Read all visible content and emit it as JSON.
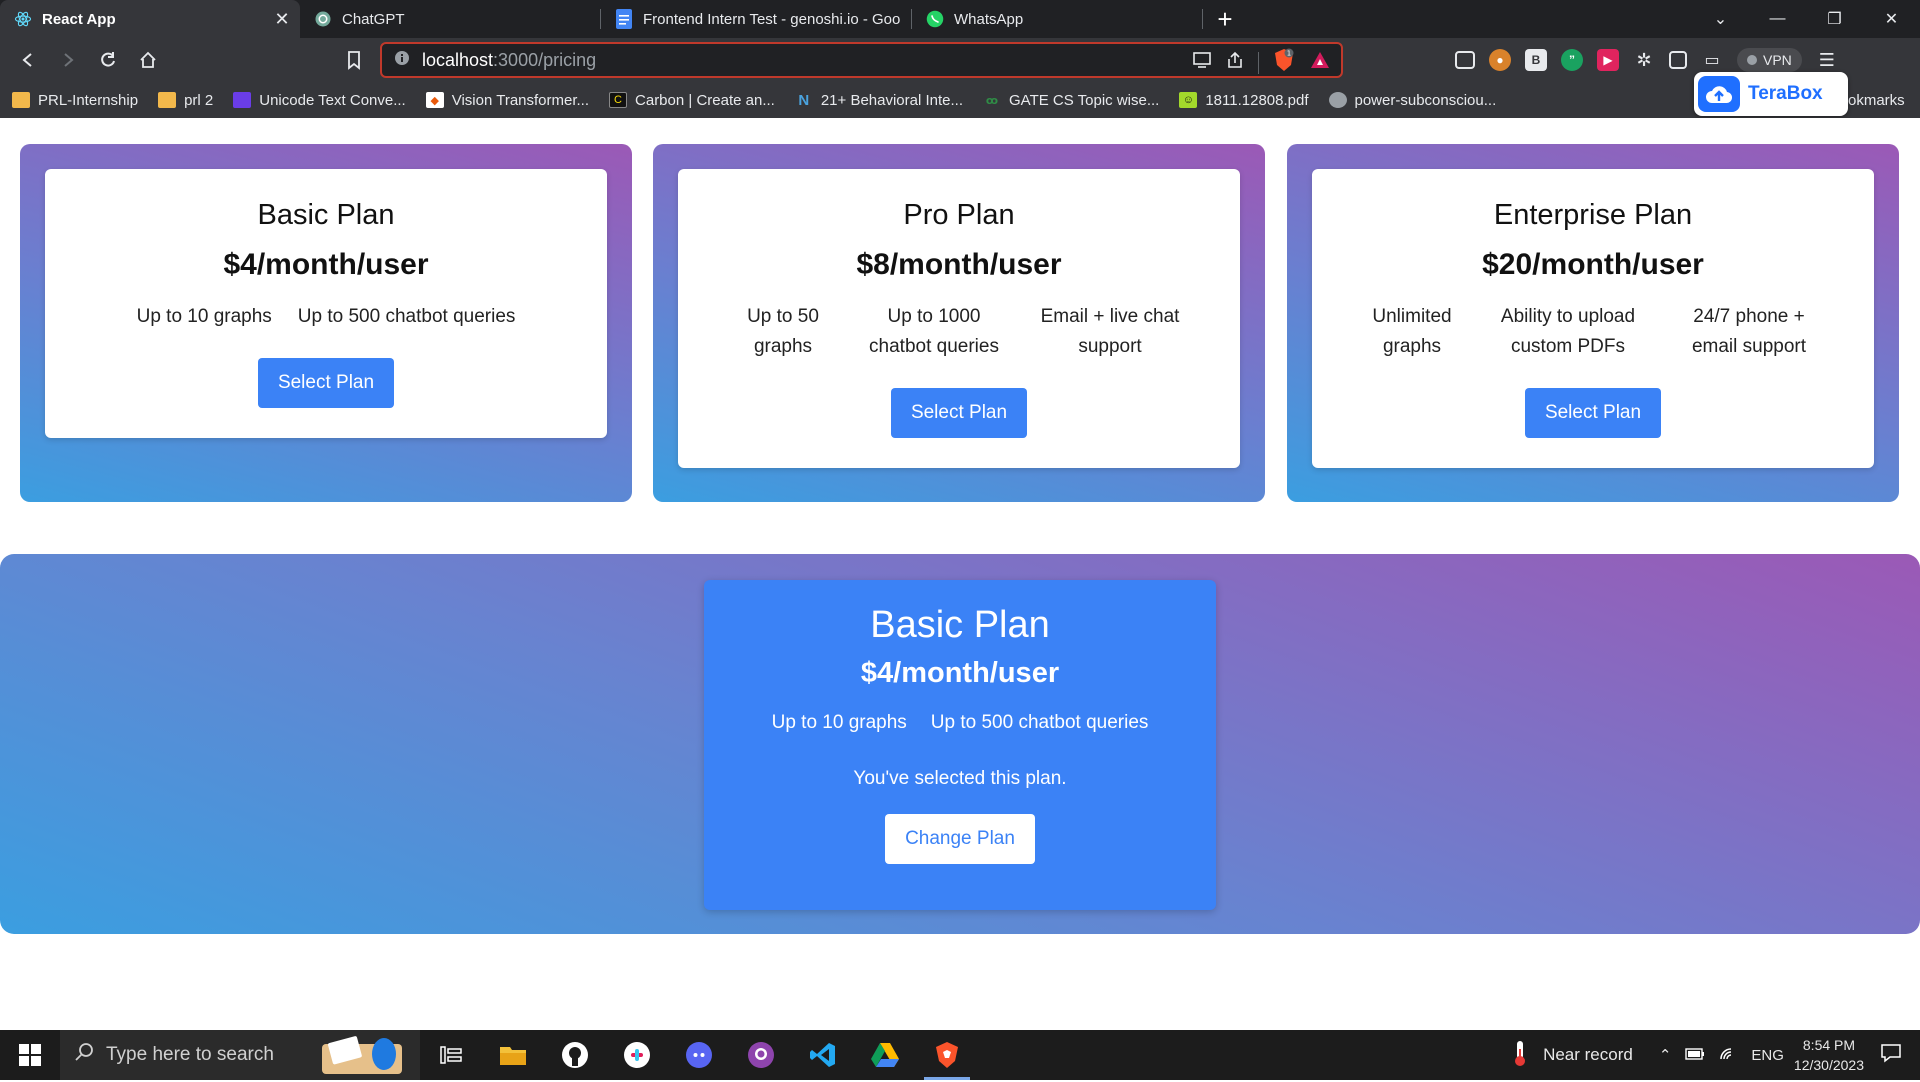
{
  "browser": {
    "tabs": [
      {
        "title": "React App",
        "active": true
      },
      {
        "title": "ChatGPT",
        "active": false
      },
      {
        "title": "Frontend Intern Test - genoshi.io - Goo",
        "active": false
      },
      {
        "title": "WhatsApp",
        "active": false
      }
    ],
    "url_host": "localhost",
    "url_path": ":3000/pricing",
    "vpn_label": "VPN",
    "bookmarks": [
      {
        "label": "PRL-Internship",
        "icon": "folder-icon"
      },
      {
        "label": "prl 2",
        "icon": "folder-icon"
      },
      {
        "label": "Unicode Text Conve...",
        "icon": "unicode-icon"
      },
      {
        "label": "Vision Transformer...",
        "icon": "vision-icon"
      },
      {
        "label": "Carbon | Create an...",
        "icon": "carbon-icon"
      },
      {
        "label": "21+ Behavioral Inte...",
        "icon": "n-icon"
      },
      {
        "label": "GATE CS Topic wise...",
        "icon": "gfg-icon"
      },
      {
        "label": "1811.12808.pdf",
        "icon": "pdf-icon"
      },
      {
        "label": "power-subconsciou...",
        "icon": "globe-icon"
      }
    ],
    "bookmarks_tail": "okmarks",
    "terabox_label": "TeraBox"
  },
  "plans": [
    {
      "name": "Basic Plan",
      "price": "$4/month/user",
      "features": [
        "Up to 10 graphs",
        "Up to 500 chatbot queries"
      ],
      "button": "Select Plan"
    },
    {
      "name": "Pro Plan",
      "price": "$8/month/user",
      "features": [
        "Up to 50 graphs",
        "Up to 1000 chatbot queries",
        "Email + live chat support"
      ],
      "button": "Select Plan"
    },
    {
      "name": "Enterprise Plan",
      "price": "$20/month/user",
      "features": [
        "Unlimited graphs",
        "Ability to upload custom PDFs",
        "24/7 phone + email support"
      ],
      "button": "Select Plan"
    }
  ],
  "selected": {
    "name": "Basic Plan",
    "price": "$4/month/user",
    "features": [
      "Up to 10 graphs",
      "Up to 500 chatbot queries"
    ],
    "message": "You've selected this plan.",
    "button": "Change Plan"
  },
  "taskbar": {
    "search_placeholder": "Type here to search",
    "weather": "Near record",
    "language": "ENG",
    "time": "8:54 PM",
    "date": "12/30/2023"
  },
  "colors": {
    "accent": "#3b82f6",
    "gradient_start": "#3b9ee0",
    "gradient_end": "#9b59b6",
    "omnibox_border": "#c0392b"
  }
}
